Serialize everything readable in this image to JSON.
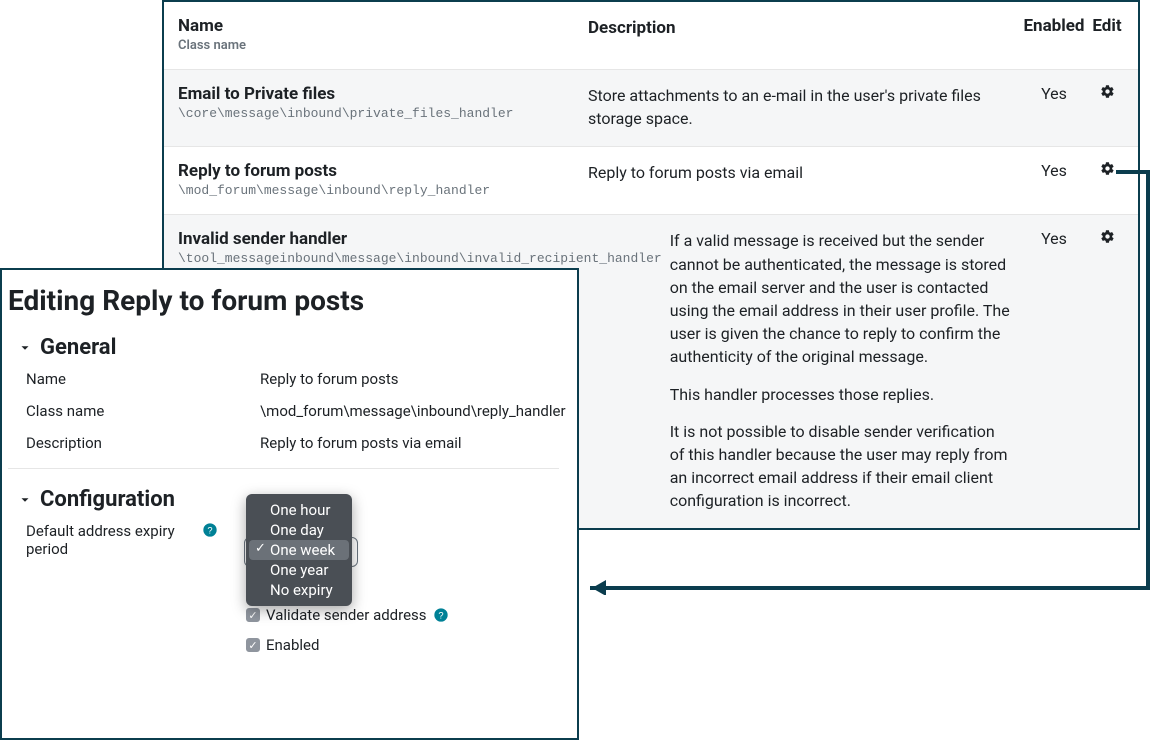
{
  "table": {
    "headers": {
      "name": "Name",
      "class_sub": "Class name",
      "description": "Description",
      "enabled": "Enabled",
      "edit": "Edit"
    },
    "rows": [
      {
        "name": "Email to Private files",
        "class": "\\core\\message\\inbound\\private_files_handler",
        "description": [
          "Store attachments to an e-mail in the user's private files storage space."
        ],
        "enabled": "Yes"
      },
      {
        "name": "Reply to forum posts",
        "class": "\\mod_forum\\message\\inbound\\reply_handler",
        "description": [
          "Reply to forum posts via email"
        ],
        "enabled": "Yes"
      },
      {
        "name": "Invalid sender handler",
        "class": "\\tool_messageinbound\\message\\inbound\\invalid_recipient_handler",
        "description": [
          "If a valid message is received but the sender cannot be authenticated, the message is stored on the email server and the user is contacted using the email address in their user profile. The user is given the chance to reply to confirm the authenticity of the original message.",
          "This handler processes those replies.",
          "It is not possible to disable sender verification of this handler because the user may reply from an incorrect email address if their email client configuration is incorrect."
        ],
        "enabled": "Yes"
      }
    ]
  },
  "panel": {
    "title": "Editing Reply to forum posts",
    "sections": {
      "general": {
        "heading": "General",
        "rows": {
          "name_label": "Name",
          "name_value": "Reply to forum posts",
          "class_label": "Class name",
          "class_value": "\\mod_forum\\message\\inbound\\reply_handler",
          "desc_label": "Description",
          "desc_value": "Reply to forum posts via email"
        }
      },
      "configuration": {
        "heading": "Configuration",
        "expiry_label": "Default address expiry period",
        "expiry_options": [
          "One hour",
          "One day",
          "One week",
          "One year",
          "No expiry"
        ],
        "expiry_selected": "One week",
        "validate_label": "Validate sender address",
        "validate_checked": true,
        "enabled_label": "Enabled",
        "enabled_checked": true
      }
    }
  }
}
